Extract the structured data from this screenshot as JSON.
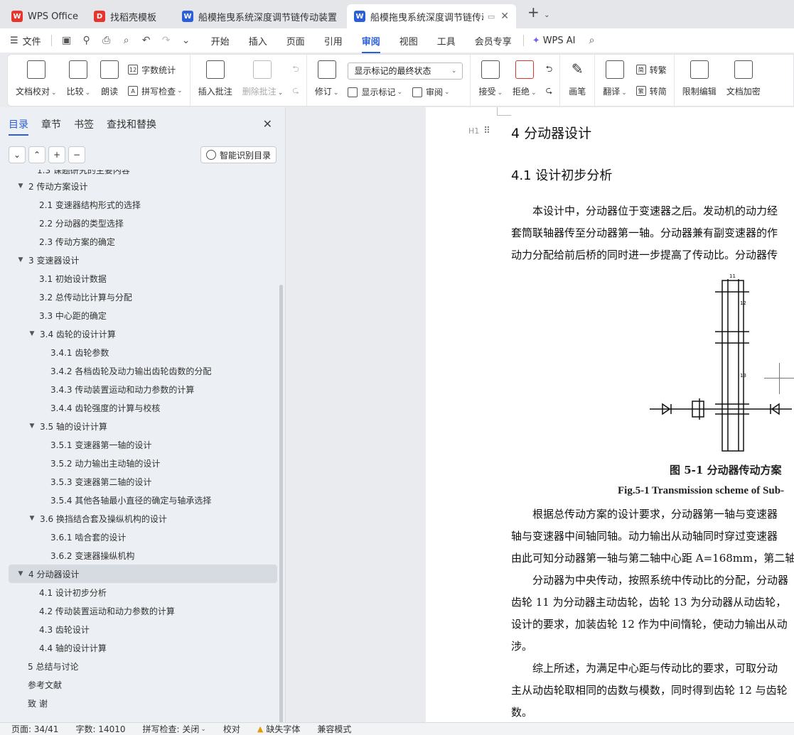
{
  "tabs": [
    {
      "label": "WPS Office",
      "icon": "wps-logo-icon",
      "color": "#e8342a",
      "active": false
    },
    {
      "label": "找稻壳模板",
      "icon": "docer-icon",
      "color": "#e8342a",
      "active": false
    },
    {
      "label": "船模拖曳系统深度调节链传动装置设计",
      "icon": "word-doc-icon",
      "color": "#2b5fd9",
      "active": false
    },
    {
      "label": "船模拖曳系统深度调节链传动",
      "icon": "word-doc-icon",
      "color": "#2b5fd9",
      "active": true
    }
  ],
  "menubar": {
    "file": "文件",
    "tabs": [
      "开始",
      "插入",
      "页面",
      "引用",
      "审阅",
      "视图",
      "工具",
      "会员专享"
    ],
    "active_tab": "审阅",
    "ai": "WPS AI"
  },
  "ribbon": {
    "doc_check": "文档校对",
    "compare": "比较",
    "read_aloud": "朗读",
    "word_count": "字数统计",
    "spell_check": "拼写检查",
    "insert_comment": "插入批注",
    "delete_comment": "删除批注",
    "revise": "修订",
    "markup_select": "显示标记的最终状态",
    "show_markup": "显示标记",
    "review": "审阅",
    "accept": "接受",
    "reject": "拒绝",
    "pen": "画笔",
    "translate": "翻译",
    "to_traditional": "转繁",
    "to_simplified": "转简",
    "restrict_edit": "限制编辑",
    "doc_encrypt": "文档加密"
  },
  "leftpanel": {
    "tabs": [
      "目录",
      "章节",
      "书签",
      "查找和替换"
    ],
    "active_tab": "目录",
    "smart_toc": "智能识别目录",
    "toc": [
      {
        "label": "1.3  课题研究的主要内容",
        "level": 2,
        "expand": false
      },
      {
        "label": "2  传动方案设计",
        "level": 1,
        "expand": true
      },
      {
        "label": "2.1  变速器结构形式的选择",
        "level": 2,
        "expand": false
      },
      {
        "label": "2.2  分动器的类型选择",
        "level": 2,
        "expand": false
      },
      {
        "label": "2.3  传动方案的确定",
        "level": 2,
        "expand": false
      },
      {
        "label": "3  变速器设计",
        "level": 1,
        "expand": true
      },
      {
        "label": "3.1  初始设计数据",
        "level": 2,
        "expand": false
      },
      {
        "label": "3.2  总传动比计算与分配",
        "level": 2,
        "expand": false
      },
      {
        "label": "3.3  中心距的确定",
        "level": 2,
        "expand": false
      },
      {
        "label": "3.4  齿轮的设计计算",
        "level": 2,
        "expand": true
      },
      {
        "label": "3.4.1  齿轮参数",
        "level": 3,
        "expand": false
      },
      {
        "label": "3.4.2  各档齿轮及动力输出齿轮齿数的分配",
        "level": 3,
        "expand": false
      },
      {
        "label": "3.4.3  传动装置运动和动力参数的计算",
        "level": 3,
        "expand": false
      },
      {
        "label": "3.4.4  齿轮强度的计算与校核",
        "level": 3,
        "expand": false
      },
      {
        "label": "3.5  轴的设计计算",
        "level": 2,
        "expand": true
      },
      {
        "label": "3.5.1  变速器第一轴的设计",
        "level": 3,
        "expand": false
      },
      {
        "label": "3.5.2  动力输出主动轴的设计",
        "level": 3,
        "expand": false
      },
      {
        "label": "3.5.3  变速器第二轴的设计",
        "level": 3,
        "expand": false
      },
      {
        "label": "3.5.4  其他各轴最小直径的确定与轴承选择",
        "level": 3,
        "expand": false
      },
      {
        "label": "3.6  换挡结合套及操纵机构的设计",
        "level": 2,
        "expand": true
      },
      {
        "label": "3.6.1  啮合套的设计",
        "level": 3,
        "expand": false
      },
      {
        "label": "3.6.2  变速器操纵机构",
        "level": 3,
        "expand": false
      },
      {
        "label": "4  分动器设计",
        "level": 1,
        "expand": true,
        "selected": true
      },
      {
        "label": "4.1  设计初步分析",
        "level": 2,
        "expand": false
      },
      {
        "label": "4.2  传动装置运动和动力参数的计算",
        "level": 2,
        "expand": false
      },
      {
        "label": "4.3  齿轮设计",
        "level": 2,
        "expand": false
      },
      {
        "label": "4.4  轴的设计计算",
        "level": 2,
        "expand": false
      },
      {
        "label": "5  总结与讨论",
        "level": 1,
        "expand": false
      },
      {
        "label": "参考文献",
        "level": 1,
        "expand": false
      },
      {
        "label": "致  谢",
        "level": 1,
        "expand": false
      }
    ]
  },
  "document": {
    "heading1": "4  分动器设计",
    "heading_marker": "H1",
    "heading2": "4.1  设计初步分析",
    "para1": [
      "　　本设计中，分动器位于变速器之后。发动机的动力经",
      "套筒联轴器传至分动器第一轴。分动器兼有副变速器的作",
      "动力分配给前后桥的同时进一步提高了传动比。分动器传"
    ],
    "figure_labels": [
      "11",
      "12",
      "13"
    ],
    "caption_cn": "图 5-1  分动器传动方案",
    "caption_en": "Fig.5-1 Transmission scheme of Sub-",
    "para2": [
      "　　根据总传动方案的设计要求，分动器第一轴与变速器",
      "轴与变速器中间轴同轴。动力输出从动轴同时穿过变速器",
      "由此可知分动器第一轴与第二轴中心距 A=168mm，第二轴",
      "　　分动器为中央传动，按照系统中传动比的分配，分动器",
      "齿轮 11 为分动器主动齿轮，齿轮 13 为分动器从动齿轮，",
      "设计的要求，加装齿轮 12 作为中间惰轮，使动力输出从动",
      "涉。",
      "　　综上所述，为满足中心距与传动比的要求，可取分动",
      "主从动齿轮取相同的齿数与模数，同时得到齿轮 12 与齿轮",
      "数。"
    ]
  },
  "statusbar": {
    "page": "页面: 34/41",
    "words": "字数: 14010",
    "spell": "拼写检查: 关闭",
    "proof": "校对",
    "missing_font": "缺失字体",
    "compat": "兼容模式"
  }
}
